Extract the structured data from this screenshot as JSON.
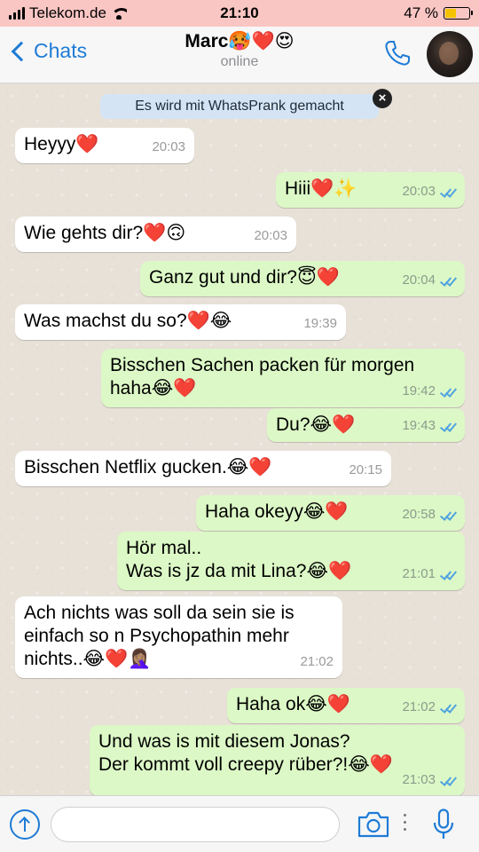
{
  "status_bar": {
    "carrier": "Telekom.de",
    "time": "21:10",
    "battery": "47 %"
  },
  "header": {
    "back_label": "Chats",
    "contact_name": "Marc🥵❤️😍",
    "contact_status": "online",
    "call_icon": "phone-icon",
    "avatar_icon": "avatar"
  },
  "banner": {
    "text": "Es wird mit WhatsPrank gemacht",
    "close_label": "×"
  },
  "messages": [
    {
      "dir": "in",
      "text": "Heyyy❤️",
      "time": "20:03"
    },
    {
      "dir": "out",
      "text": "Hiii❤️✨",
      "time": "20:03"
    },
    {
      "dir": "in",
      "text": "Wie gehts dir?❤️🙃",
      "time": "20:03"
    },
    {
      "dir": "out",
      "text": "Ganz gut und dir?😇❤️",
      "time": "20:04"
    },
    {
      "dir": "in",
      "text": "Was machst du so?❤️😂",
      "time": "19:39"
    },
    {
      "dir": "out",
      "text": "Bisschen Sachen packen für morgen\nhaha😂❤️",
      "time": "19:42"
    },
    {
      "dir": "out",
      "text": "Du?😂❤️",
      "time": "19:43"
    },
    {
      "dir": "in",
      "text": "Bisschen Netflix gucken.😂❤️",
      "time": "20:15"
    },
    {
      "dir": "out",
      "text": "Haha okeyy😂❤️",
      "time": "20:58"
    },
    {
      "dir": "out",
      "text": "Hör mal..\nWas is jz da mit Lina?😂❤️",
      "time": "21:01"
    },
    {
      "dir": "in",
      "text": "Ach nichts was soll da sein sie is\neinfach so n Psychopathin mehr\nnichts..😂❤️🤦🏽‍♀️",
      "time": "21:02"
    },
    {
      "dir": "out",
      "text": "Haha ok😂❤️",
      "time": "21:02"
    },
    {
      "dir": "out",
      "text": "Und was is mit diesem Jonas?\nDer kommt voll creepy rüber?!😂❤️",
      "time": "21:03"
    }
  ],
  "composer": {
    "attach_icon": "upload-icon",
    "placeholder": "",
    "camera_icon": "camera-icon",
    "mic_icon": "microphone-icon"
  }
}
